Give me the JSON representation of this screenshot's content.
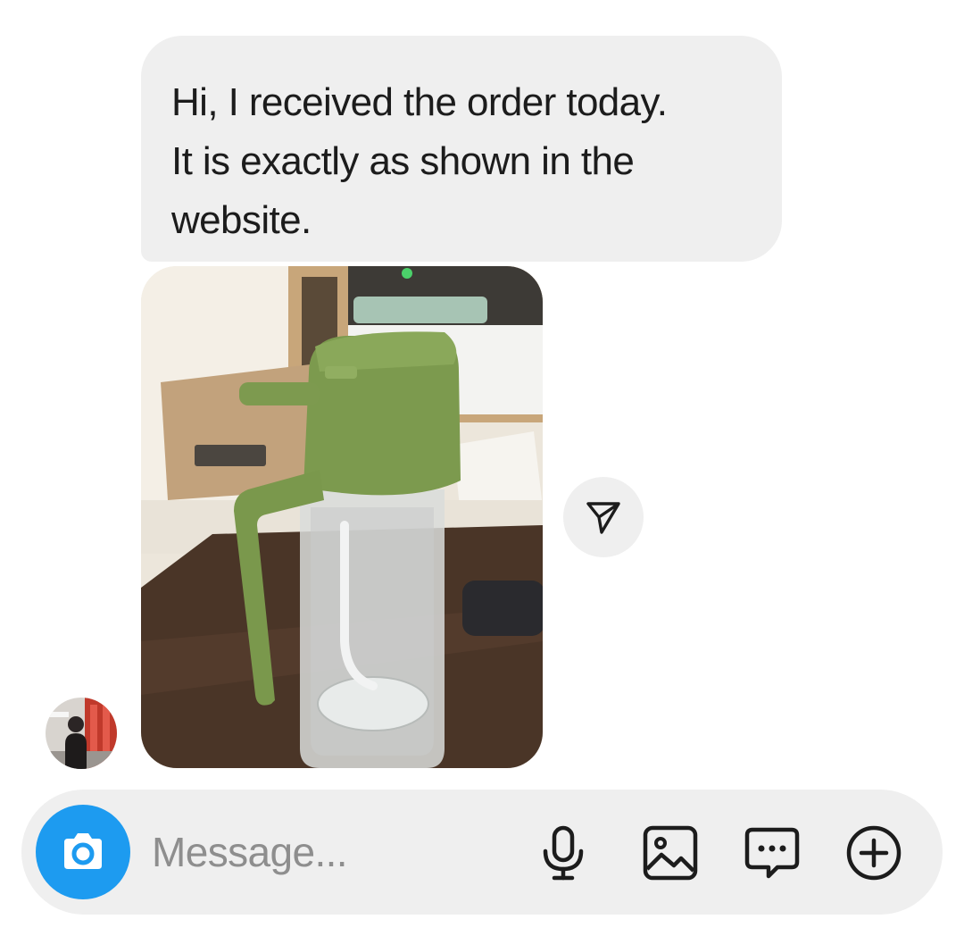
{
  "thread": {
    "incoming_message": {
      "text": "Hi, I received the order today.\nIt is exactly as shown in the\nwebsite."
    },
    "photo": {
      "subject": "glass oil bottle with green lid and handle"
    },
    "share_button": {
      "icon": "paper-plane-icon"
    },
    "sender_avatar": {
      "icon": "profile-photo"
    }
  },
  "composer": {
    "placeholder": "Message...",
    "value": "",
    "camera_icon": "camera-icon",
    "tools": [
      {
        "icon": "microphone-icon"
      },
      {
        "icon": "gallery-icon"
      },
      {
        "icon": "sticker-chat-icon"
      },
      {
        "icon": "plus-circle-icon"
      }
    ]
  },
  "colors": {
    "bubble": "#efefef",
    "accent": "#1d9bf0",
    "text": "#1c1c1c",
    "placeholder": "#8e8e8e"
  }
}
